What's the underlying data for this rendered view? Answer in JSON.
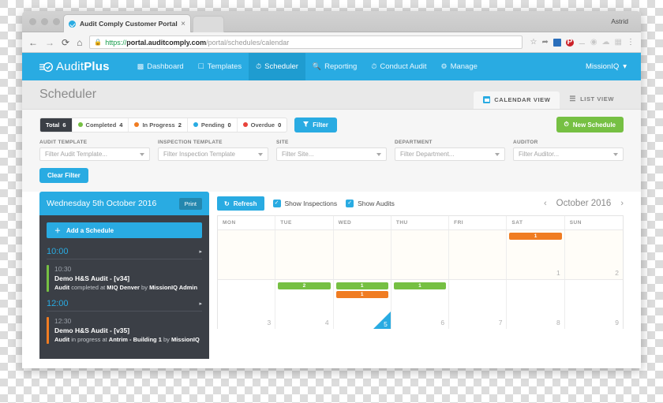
{
  "browser": {
    "tab_title": "Audit Comply Customer Portal",
    "tab_close": "×",
    "favicon": "audit-comply-favicon",
    "window_user": "Astrid",
    "back": "←",
    "forward": "→",
    "reload": "⟳",
    "home": "⌂",
    "lock": "🔒",
    "url_scheme": "https://",
    "url_host": "portal.auditcomply.com",
    "url_path": "/portal/schedules/calendar",
    "extensions": [
      "star-icon",
      "send-icon",
      "bluebox-icon",
      "pinterest-icon",
      "dash-icon",
      "circle-icon",
      "cloud-icon",
      "wc-icon",
      "menu-icon"
    ]
  },
  "nav": {
    "brand": "AuditPlus",
    "brand_prefix": "Audit",
    "brand_suffix": "Plus",
    "items": [
      {
        "label": "Dashboard",
        "icon": "bar-chart-icon",
        "glyph": "▐",
        "active": false
      },
      {
        "label": "Templates",
        "icon": "document-icon",
        "glyph": "❐",
        "active": false
      },
      {
        "label": "Scheduler",
        "icon": "clock-icon",
        "glyph": "◷",
        "active": true
      },
      {
        "label": "Reporting",
        "icon": "magnifier-icon",
        "glyph": "⚲",
        "active": false
      },
      {
        "label": "Conduct Audit",
        "icon": "clock-icon",
        "glyph": "◷",
        "active": false
      },
      {
        "label": "Manage",
        "icon": "gear-icon",
        "glyph": "⚙",
        "active": false
      }
    ],
    "user": "MissionIQ",
    "user_caret": "▾"
  },
  "page": {
    "title": "Scheduler",
    "view_tabs": [
      {
        "label": "CALENDAR VIEW",
        "icon": "calendar-icon",
        "active": true
      },
      {
        "label": "LIST VIEW",
        "icon": "list-icon",
        "active": false
      }
    ]
  },
  "status_badges": [
    {
      "label": "Total",
      "count": "6",
      "color": "#3b3f46",
      "type": "total"
    },
    {
      "label": "Completed",
      "count": "4",
      "color": "#76c043",
      "type": "completed"
    },
    {
      "label": "In Progress",
      "count": "2",
      "color": "#f07c22",
      "type": "in-progress"
    },
    {
      "label": "Pending",
      "count": "0",
      "color": "#29abe2",
      "type": "pending"
    },
    {
      "label": "Overdue",
      "count": "0",
      "color": "#e8433b",
      "type": "overdue"
    }
  ],
  "buttons": {
    "filter": "Filter",
    "filter_icon": "funnel-icon",
    "filter_glyph": "▼",
    "new_schedule": "New Schedule",
    "new_schedule_icon": "clock-icon",
    "new_schedule_glyph": "◷",
    "clear_filter": "Clear Filter",
    "print": "Print",
    "add_schedule": "Add a Schedule",
    "add_schedule_glyph": "＋",
    "refresh": "Refresh",
    "refresh_glyph": "↻"
  },
  "filters": [
    {
      "label": "AUDIT TEMPLATE",
      "placeholder": "Filter Audit Template...",
      "value": ""
    },
    {
      "label": "INSPECTION TEMPLATE",
      "placeholder": "Filter Inspection Template",
      "value": ""
    },
    {
      "label": "SITE",
      "placeholder": "Filter Site...",
      "value": ""
    },
    {
      "label": "DEPARTMENT",
      "placeholder": "Filter Department...",
      "value": ""
    },
    {
      "label": "AUDITOR",
      "placeholder": "Filter Auditor...",
      "value": ""
    }
  ],
  "day_panel": {
    "date": "Wednesday 5th October 2016",
    "slots": [
      {
        "time": "10:00",
        "arrow": "▸",
        "events": [
          {
            "time": "10:30",
            "title": "Demo H&S Audit - [v34]",
            "kind": "Audit",
            "status_text": " completed at ",
            "location": "MIQ Denver",
            "by_text": " by ",
            "person": "MissionIQ Admin",
            "state": "completed"
          }
        ]
      },
      {
        "time": "12:00",
        "arrow": "▸",
        "events": [
          {
            "time": "12:30",
            "title": "Demo H&S Audit - [v35]",
            "kind": "Audit",
            "status_text": " in progress at ",
            "location": "Antrim - Building 1",
            "by_text": " by ",
            "person": "MissionIQ",
            "state": "inprogress"
          }
        ]
      }
    ]
  },
  "calendar": {
    "toggles": [
      {
        "label": "Show Inspections",
        "checked": true,
        "check": "✓"
      },
      {
        "label": "Show Audits",
        "checked": true,
        "check": "✓"
      }
    ],
    "month_label": "October 2016",
    "prev": "‹",
    "next": "›",
    "dow": [
      "MON",
      "TUE",
      "WED",
      "THU",
      "FRI",
      "SAT",
      "SUN"
    ],
    "weeks": [
      {
        "lower": false,
        "days": [
          {
            "num": "",
            "events": [],
            "selected": false
          },
          {
            "num": "",
            "events": [],
            "selected": false
          },
          {
            "num": "",
            "events": [],
            "selected": false
          },
          {
            "num": "",
            "events": [],
            "selected": false
          },
          {
            "num": "",
            "events": [],
            "selected": false
          },
          {
            "num": "1",
            "events": [
              {
                "count": "1",
                "color": "orange"
              }
            ],
            "selected": false
          },
          {
            "num": "2",
            "events": [],
            "selected": false
          }
        ]
      },
      {
        "lower": true,
        "days": [
          {
            "num": "3",
            "events": [],
            "selected": false
          },
          {
            "num": "4",
            "events": [
              {
                "count": "2",
                "color": "green"
              }
            ],
            "selected": false
          },
          {
            "num": "5",
            "events": [
              {
                "count": "1",
                "color": "green"
              },
              {
                "count": "1",
                "color": "orange"
              }
            ],
            "selected": true
          },
          {
            "num": "6",
            "events": [
              {
                "count": "1",
                "color": "green"
              }
            ],
            "selected": false
          },
          {
            "num": "7",
            "events": [],
            "selected": false
          },
          {
            "num": "8",
            "events": [],
            "selected": false
          },
          {
            "num": "9",
            "events": [],
            "selected": false
          }
        ]
      }
    ]
  }
}
